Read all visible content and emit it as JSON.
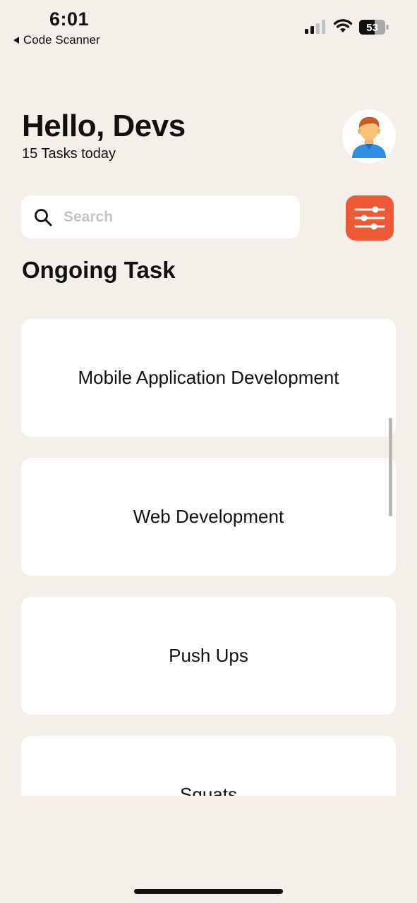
{
  "status_bar": {
    "time": "6:01",
    "back_label": "Code Scanner",
    "battery": "53"
  },
  "header": {
    "greeting": "Hello, Devs",
    "subtitle": "15 Tasks today"
  },
  "search": {
    "placeholder": "Search",
    "value": ""
  },
  "section_title": "Ongoing Task",
  "tasks": [
    {
      "title": "Mobile Application Development"
    },
    {
      "title": "Web Development"
    },
    {
      "title": "Push Ups"
    },
    {
      "title": "Squats"
    }
  ],
  "colors": {
    "background": "#f5efe9",
    "accent": "#ef5a35",
    "card": "#ffffff"
  },
  "icons": {
    "search": "search-icon",
    "filter": "sliders-icon",
    "avatar": "person-avatar-icon"
  }
}
